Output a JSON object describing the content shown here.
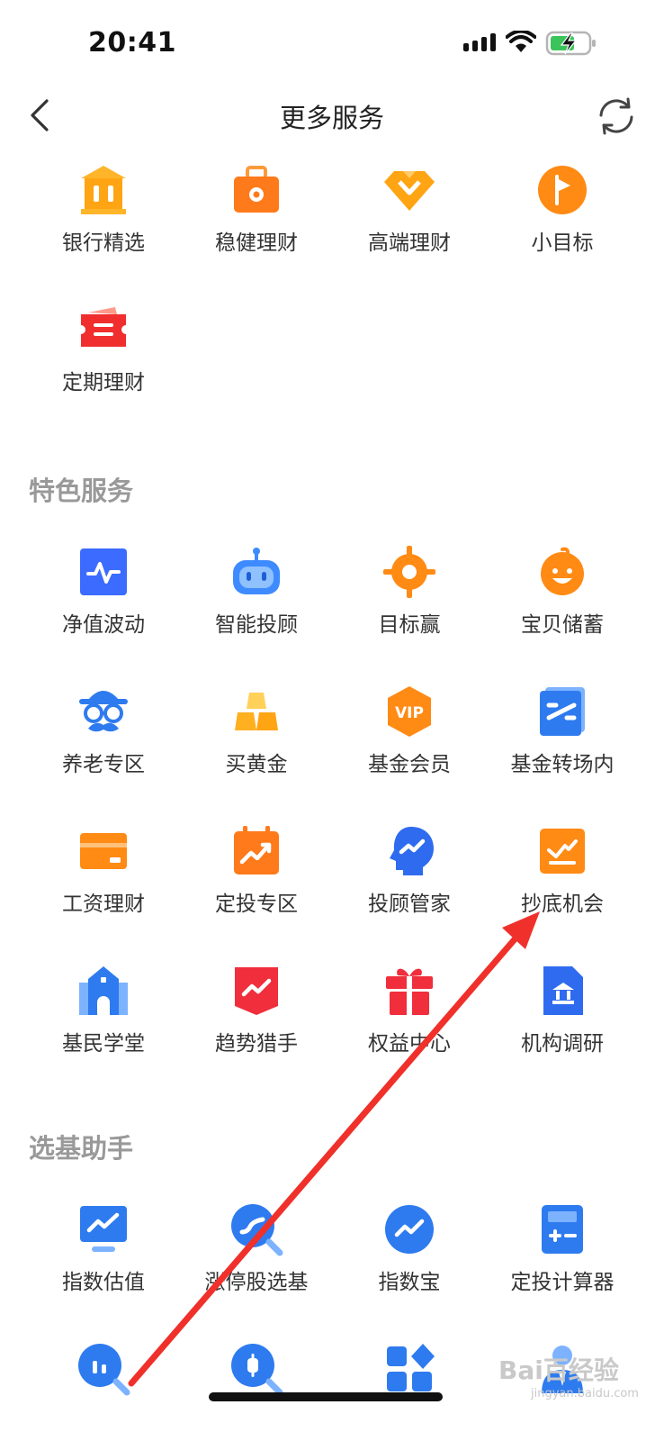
{
  "status_bar": {
    "time": "20:41"
  },
  "header": {
    "title": "更多服务"
  },
  "top_services": [
    {
      "label": "银行精选",
      "icon": "bank-icon",
      "color": "#FFA412"
    },
    {
      "label": "稳健理财",
      "icon": "briefcase-icon",
      "color": "#FF7A1A"
    },
    {
      "label": "高端理财",
      "icon": "diamond-icon",
      "color": "#FFA412"
    },
    {
      "label": "小目标",
      "icon": "flag-icon",
      "color": "#FF8A14"
    },
    {
      "label": "定期理财",
      "icon": "ticket-icon",
      "color": "#F02E2E"
    }
  ],
  "special_services": {
    "title": "特色服务",
    "items": [
      {
        "label": "净值波动",
        "icon": "pulse-chart-icon",
        "color": "#3B6CFF"
      },
      {
        "label": "智能投顾",
        "icon": "robot-icon",
        "color": "#3E8BFF"
      },
      {
        "label": "目标赢",
        "icon": "target-icon",
        "color": "#FF8A14"
      },
      {
        "label": "宝贝储蓄",
        "icon": "baby-face-icon",
        "color": "#FF8A14"
      },
      {
        "label": "养老专区",
        "icon": "old-man-icon",
        "color": "#2E7BEF"
      },
      {
        "label": "买黄金",
        "icon": "gold-bars-icon",
        "color": "#FFB020"
      },
      {
        "label": "基金会员",
        "icon": "vip-icon",
        "color": "#FF8A14"
      },
      {
        "label": "基金转场内",
        "icon": "transfer-icon",
        "color": "#2E7BEF"
      },
      {
        "label": "工资理财",
        "icon": "card-icon",
        "color": "#FF8A14"
      },
      {
        "label": "定投专区",
        "icon": "calendar-chart-icon",
        "color": "#FF7A1A"
      },
      {
        "label": "投顾管家",
        "icon": "advisor-head-icon",
        "color": "#2E6BEF"
      },
      {
        "label": "抄底机会",
        "icon": "bottom-fishing-icon",
        "color": "#FF8A14"
      },
      {
        "label": "基民学堂",
        "icon": "school-icon",
        "color": "#2E7BEF"
      },
      {
        "label": "趋势猎手",
        "icon": "trend-shield-icon",
        "color": "#F02E3C"
      },
      {
        "label": "权益中心",
        "icon": "gift-icon",
        "color": "#F02E3C"
      },
      {
        "label": "机构调研",
        "icon": "institution-icon",
        "color": "#2E6BEF"
      }
    ]
  },
  "fund_helper": {
    "title": "选基助手",
    "items": [
      {
        "label": "指数估值",
        "icon": "monitor-chart-icon",
        "color": "#2E7BEF"
      },
      {
        "label": "涨停股选基",
        "icon": "search-trend-icon",
        "color": "#2E7BEF"
      },
      {
        "label": "指数宝",
        "icon": "trend-circle-icon",
        "color": "#2E7BEF"
      },
      {
        "label": "定投计算器",
        "icon": "calculator-icon",
        "color": "#2E7BEF"
      },
      {
        "label": "",
        "icon": "search-bars-icon",
        "color": "#2E7BEF"
      },
      {
        "label": "",
        "icon": "search-candle-icon",
        "color": "#2E7BEF"
      },
      {
        "label": "",
        "icon": "grid-icon",
        "color": "#2E7BEF"
      },
      {
        "label": "",
        "icon": "manager-icon",
        "color": "#2E7BEF"
      }
    ]
  },
  "annotation": {
    "color": "#F0302A"
  },
  "watermark": {
    "text": "Bai百经验",
    "sub": "jingyan.baidu.com"
  }
}
